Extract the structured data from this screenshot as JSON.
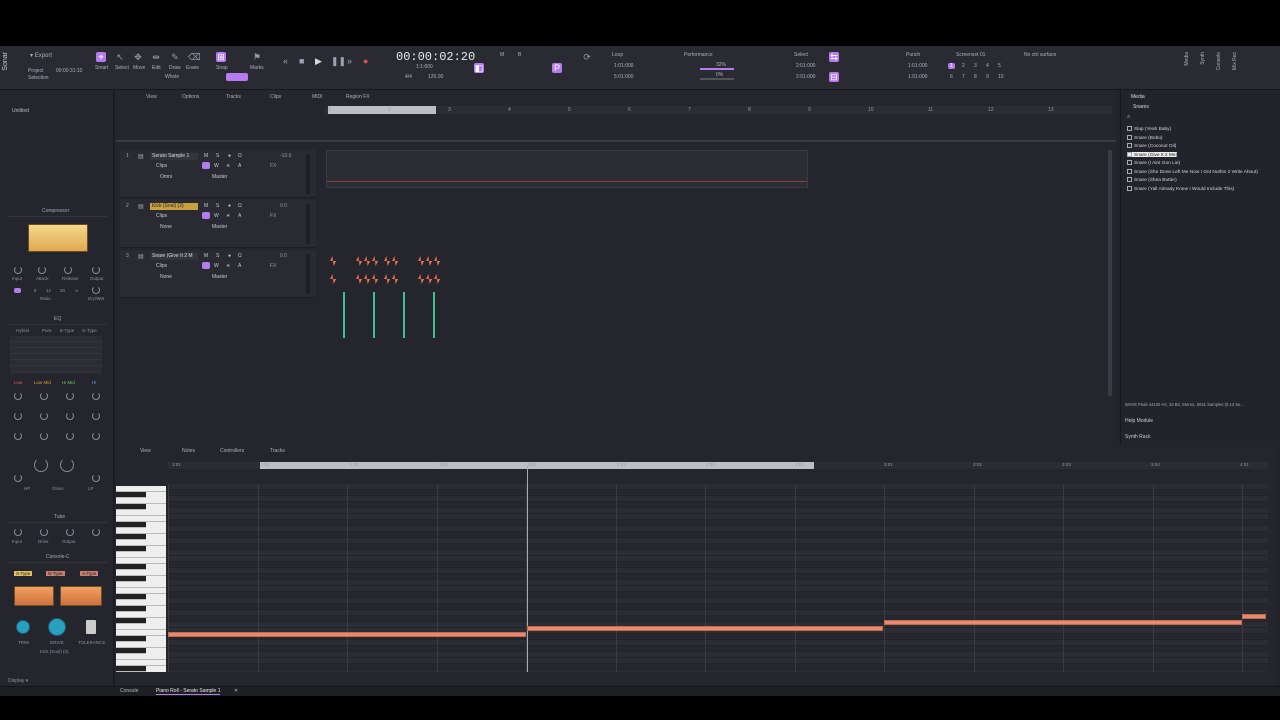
{
  "app": {
    "name": "Sonar"
  },
  "toolbar": {
    "export": "Export",
    "project": "Project",
    "selection": "Selection",
    "project_time": "00:00:31:10",
    "tools": [
      "Smart",
      "Select",
      "Move",
      "Edit",
      "Draw",
      "Erase"
    ],
    "snap": "Snap",
    "snap_value": "Whole",
    "marks": "Marks",
    "timecode": "00:00:02:20",
    "position": "1:1:600",
    "tempo": "120.00",
    "meter": "4/4",
    "loop": "Loop",
    "loop_start": "1:01:000",
    "loop_end": "5:01:000",
    "performance": "Performance",
    "perf_cpu": "32%",
    "perf_disk": "0%",
    "select_label": "Select",
    "select_start": "2:01:000",
    "select_end": "2:01:000",
    "punch": "Punch",
    "punch_start": "1:01:000",
    "punch_end": "1:01:000",
    "screenset": "Screenset 01",
    "screenset_nums": [
      "1",
      "2",
      "3",
      "4",
      "5",
      "6",
      "7",
      "8",
      "9",
      "10"
    ],
    "control_surface": "No ctrl surface",
    "side_labels": [
      "Media",
      "Synth",
      "Console",
      "Mix Rec"
    ]
  },
  "left": {
    "project_name": "Untitled",
    "compressor": {
      "title": "Compressor",
      "knobs": [
        "Input",
        "Attack",
        "Release",
        "Output"
      ],
      "ratio_label": "Ratio",
      "ratio_values": [
        "4",
        "8",
        "12",
        "20",
        "∞"
      ],
      "drywet": "Dry/Wet"
    },
    "eq": {
      "title": "EQ",
      "types": [
        "Hybrid",
        "Pure",
        "E-Type",
        "G-Type"
      ],
      "bands": [
        "Low",
        "Low Mid",
        "Hi Mid",
        "Hi"
      ],
      "bottom": [
        "HP",
        "Gloss",
        "LP"
      ]
    },
    "tube": {
      "title": "Tube",
      "knobs": [
        "Input",
        "Drive",
        "Output"
      ]
    },
    "console": {
      "title": "Console-C",
      "types": [
        "S-Type",
        "N-Type",
        "A-Type"
      ],
      "knobs": [
        "TRIM",
        "DRIVE",
        "TOLERANCE"
      ],
      "track": "Kick (Soul) (2)"
    },
    "display": "Display"
  },
  "trackview": {
    "menu": [
      "View",
      "Options",
      "Tracks",
      "Clips",
      "MIDI",
      "Region FX"
    ],
    "ruler": [
      "1",
      "2",
      "3",
      "4",
      "5",
      "6",
      "7",
      "8",
      "9",
      "10",
      "11",
      "12",
      "13"
    ],
    "tracks": [
      {
        "num": "1",
        "name": "Serato Sample 1",
        "mode": "Clips",
        "input": "Omni",
        "output": "Master",
        "vol": "-10.6"
      },
      {
        "num": "2",
        "name": "Kick (Soul) (2)",
        "mode": "Clips",
        "input": "None",
        "output": "Master",
        "vol": "0.0"
      },
      {
        "num": "3",
        "name": "Snare (Give It 2 M",
        "mode": "Clips",
        "input": "None",
        "output": "Master",
        "vol": "0.0"
      }
    ],
    "btns": [
      "M",
      "S",
      "●",
      "Ω"
    ],
    "btns2": [
      "W",
      "∗",
      "A"
    ],
    "fx": "FX"
  },
  "browser": {
    "tab": "Media",
    "folder": "Snares",
    "items": [
      "Slap (Yeah Baby)",
      "Snare (Bobo)",
      "Snare (Coconut Oil)",
      "Snare (Give It 2 Me)",
      "Snare (I Aint Gon Lie)",
      "Snare (She Done Left Me Now I Got Nuthin 2 Write About)",
      "Snare (Shea Butter)",
      "Snare (Yall Already Knew I Would Include This)"
    ],
    "selected": 3,
    "fileinfo": "WAVE Peak 44100 Hz, 32 Bit, Stereo, 6041 Samples (0.13 Se...",
    "help": "Help Module",
    "synth_rack": "Synth Rack"
  },
  "pianoroll": {
    "menu": [
      "View",
      "Notes",
      "Controllers",
      "Tracks"
    ],
    "ruler": [
      "1:01",
      "1:02",
      "1:03",
      "1:04",
      "2:01",
      "2:02",
      "2:03",
      "2:04",
      "3:01",
      "3:02",
      "3:03",
      "3:04",
      "4:01"
    ]
  },
  "status": {
    "tabs": [
      "Console",
      "Piano Roll - Serato Sample 1"
    ]
  },
  "colors": {
    "accent": "#b57cf0",
    "note": "#e88a70",
    "clip_kick": "#e06040",
    "clip_snare": "#40c090"
  }
}
